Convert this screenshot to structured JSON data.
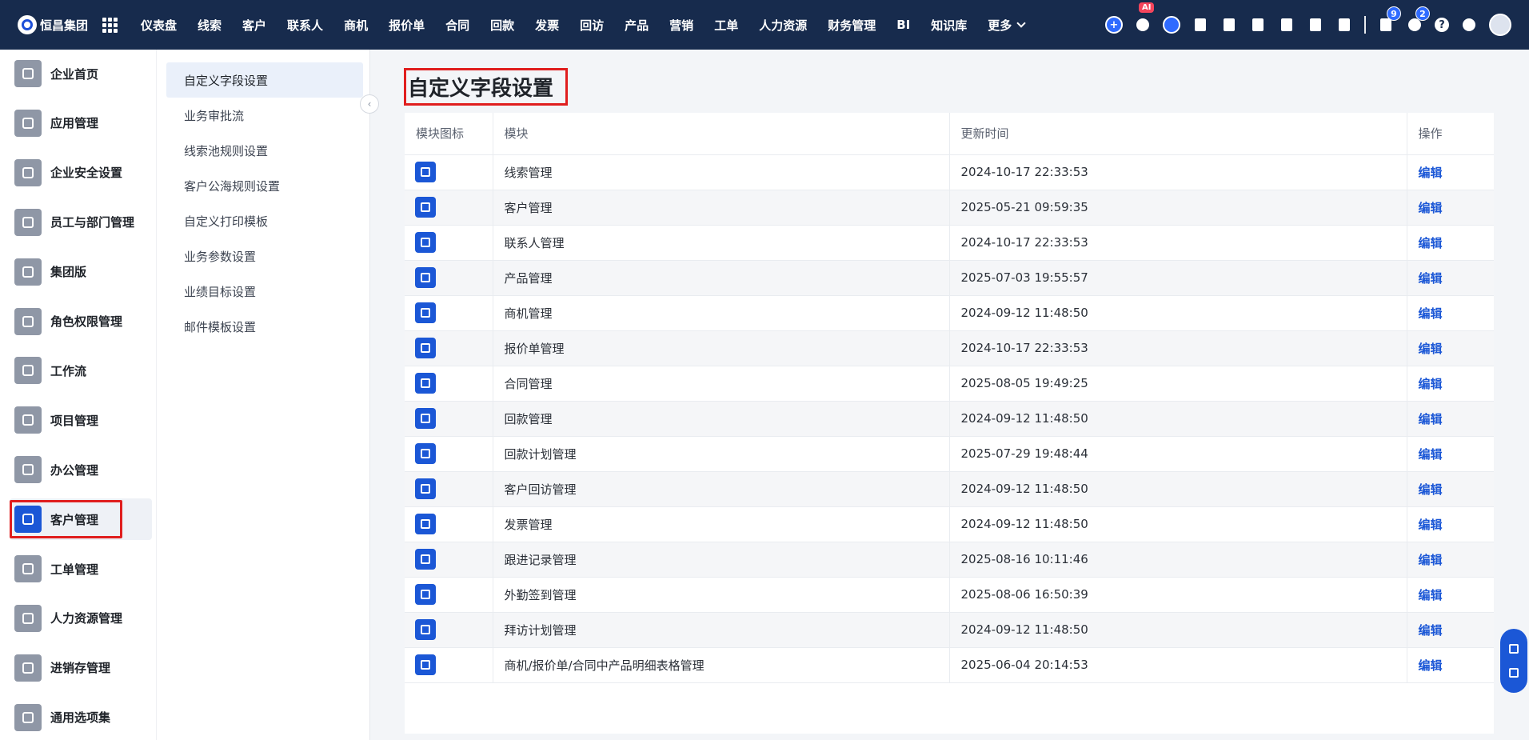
{
  "brand": {
    "name": "恒昌集团"
  },
  "nav": [
    "仪表盘",
    "线索",
    "客户",
    "联系人",
    "商机",
    "报价单",
    "合同",
    "回款",
    "发票",
    "回访",
    "产品",
    "营销",
    "工单",
    "人力资源",
    "财务管理",
    "BI",
    "知识库",
    "更多"
  ],
  "header_tools": {
    "ai_badge": "AI",
    "task_count": "9",
    "notification_count": "2",
    "help": "?"
  },
  "sidebar": {
    "items": [
      {
        "label": "企业首页",
        "icon": "home-icon"
      },
      {
        "label": "应用管理",
        "icon": "apps-icon"
      },
      {
        "label": "企业安全设置",
        "icon": "shield-icon"
      },
      {
        "label": "员工与部门管理",
        "icon": "people-icon"
      },
      {
        "label": "集团版",
        "icon": "group-icon"
      },
      {
        "label": "角色权限管理",
        "icon": "role-icon"
      },
      {
        "label": "工作流",
        "icon": "workflow-icon"
      },
      {
        "label": "项目管理",
        "icon": "folder-icon"
      },
      {
        "label": "办公管理",
        "icon": "briefcase-icon"
      },
      {
        "label": "客户管理",
        "icon": "building-icon"
      },
      {
        "label": "工单管理",
        "icon": "clipboard-icon"
      },
      {
        "label": "人力资源管理",
        "icon": "user-icon"
      },
      {
        "label": "进销存管理",
        "icon": "box-icon"
      },
      {
        "label": "通用选项集",
        "icon": "options-icon"
      }
    ],
    "active_index": 9
  },
  "submenu": {
    "items": [
      "自定义字段设置",
      "业务审批流",
      "线索池规则设置",
      "客户公海规则设置",
      "自定义打印模板",
      "业务参数设置",
      "业绩目标设置",
      "邮件模板设置"
    ]
  },
  "page": {
    "title": "自定义字段设置"
  },
  "table": {
    "headers": [
      "模块图标",
      "模块",
      "更新时间",
      "操作"
    ],
    "edit_label": "编辑",
    "rows": [
      {
        "module": "线索管理",
        "updated": "2024-10-17 22:33:53"
      },
      {
        "module": "客户管理",
        "updated": "2025-05-21 09:59:35"
      },
      {
        "module": "联系人管理",
        "updated": "2024-10-17 22:33:53"
      },
      {
        "module": "产品管理",
        "updated": "2025-07-03 19:55:57"
      },
      {
        "module": "商机管理",
        "updated": "2024-09-12 11:48:50"
      },
      {
        "module": "报价单管理",
        "updated": "2024-10-17 22:33:53"
      },
      {
        "module": "合同管理",
        "updated": "2025-08-05 19:49:25"
      },
      {
        "module": "回款管理",
        "updated": "2024-09-12 11:48:50"
      },
      {
        "module": "回款计划管理",
        "updated": "2025-07-29 19:48:44"
      },
      {
        "module": "客户回访管理",
        "updated": "2024-09-12 11:48:50"
      },
      {
        "module": "发票管理",
        "updated": "2024-09-12 11:48:50"
      },
      {
        "module": "跟进记录管理",
        "updated": "2025-08-16 10:11:46"
      },
      {
        "module": "外勤签到管理",
        "updated": "2025-08-06 16:50:39"
      },
      {
        "module": "拜访计划管理",
        "updated": "2024-09-12 11:48:50"
      },
      {
        "module": "商机/报价单/合同中产品明细表格管理",
        "updated": "2025-06-04 20:14:53"
      }
    ]
  },
  "colors": {
    "topbar": "#172b4d",
    "accent": "#1b57d6",
    "highlight": "#e01e1e"
  }
}
